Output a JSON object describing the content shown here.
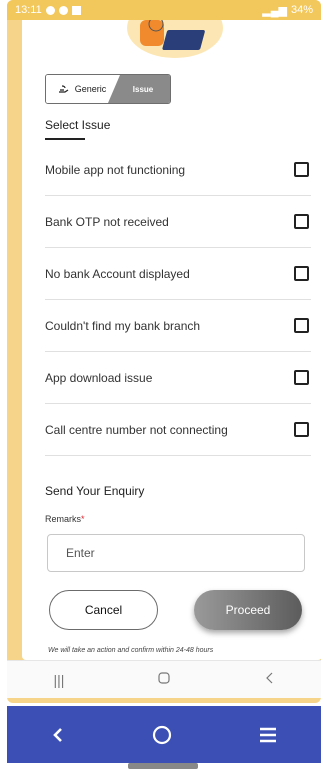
{
  "status_bar": {
    "time": "13:11",
    "right": "34%"
  },
  "tabs": {
    "generic": "Generic",
    "issue": "Issue"
  },
  "section_title": "Select Issue",
  "issues": [
    {
      "label": "Mobile app not functioning",
      "checked": false
    },
    {
      "label": "Bank OTP not received",
      "checked": false
    },
    {
      "label": "No bank Account displayed",
      "checked": false
    },
    {
      "label": "Couldn't find my bank branch",
      "checked": false
    },
    {
      "label": "App download issue",
      "checked": false
    },
    {
      "label": "Call centre number not connecting",
      "checked": false
    }
  ],
  "enquiry": {
    "title": "Send Your Enquiry",
    "remarks_label": "Remarks",
    "required_mark": "*",
    "placeholder": "Enter",
    "value": ""
  },
  "buttons": {
    "cancel": "Cancel",
    "proceed": "Proceed"
  },
  "footnote": "We will take an action and confirm within 24-48 hours",
  "colors": {
    "accent": "#f2c85c",
    "nav_bar": "#3b4fb4",
    "required": "#e0262f"
  },
  "icons": {
    "inner_nav": [
      "recent-apps-icon",
      "home-icon",
      "back-icon"
    ],
    "system_nav": [
      "back-icon",
      "home-icon",
      "menu-icon"
    ]
  }
}
